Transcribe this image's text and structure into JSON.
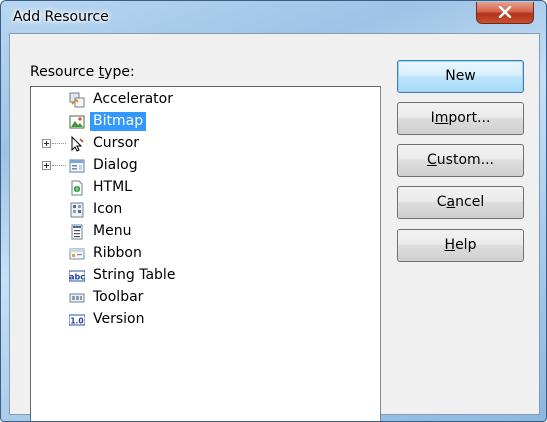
{
  "window": {
    "title": "Add Resource"
  },
  "dialog": {
    "resource_type_prefix": "Resource ",
    "resource_type_mnemonic": "t",
    "resource_type_suffix": "ype:",
    "tree_items": [
      {
        "label": "Accelerator",
        "icon": "accelerator-icon",
        "expandable": false,
        "selected": false
      },
      {
        "label": "Bitmap",
        "icon": "bitmap-icon",
        "expandable": false,
        "selected": true
      },
      {
        "label": "Cursor",
        "icon": "cursor-icon",
        "expandable": true,
        "selected": false
      },
      {
        "label": "Dialog",
        "icon": "dialog-icon",
        "expandable": true,
        "selected": false
      },
      {
        "label": "HTML",
        "icon": "html-icon",
        "expandable": false,
        "selected": false
      },
      {
        "label": "Icon",
        "icon": "icon-resource-icon",
        "expandable": false,
        "selected": false
      },
      {
        "label": "Menu",
        "icon": "menu-icon",
        "expandable": false,
        "selected": false
      },
      {
        "label": "Ribbon",
        "icon": "ribbon-icon",
        "expandable": false,
        "selected": false
      },
      {
        "label": "String Table",
        "icon": "string-table-icon",
        "expandable": false,
        "selected": false
      },
      {
        "label": "Toolbar",
        "icon": "toolbar-icon",
        "expandable": false,
        "selected": false
      },
      {
        "label": "Version",
        "icon": "version-icon",
        "expandable": false,
        "selected": false
      }
    ],
    "buttons": {
      "new": {
        "label": "New"
      },
      "import": {
        "pre": "I",
        "mnemonic": "m",
        "post": "port..."
      },
      "custom": {
        "pre": "",
        "mnemonic": "C",
        "post": "ustom..."
      },
      "cancel": {
        "pre": "C",
        "mnemonic": "a",
        "post": "ncel"
      },
      "help": {
        "pre": "",
        "mnemonic": "H",
        "post": "elp"
      }
    }
  },
  "glyph_text": {
    "string_table": "abc",
    "version": "1.0"
  },
  "colors": {
    "selection": "#3399ff",
    "close_button": "#c8502f",
    "default_button_border": "#3c7fb1"
  }
}
